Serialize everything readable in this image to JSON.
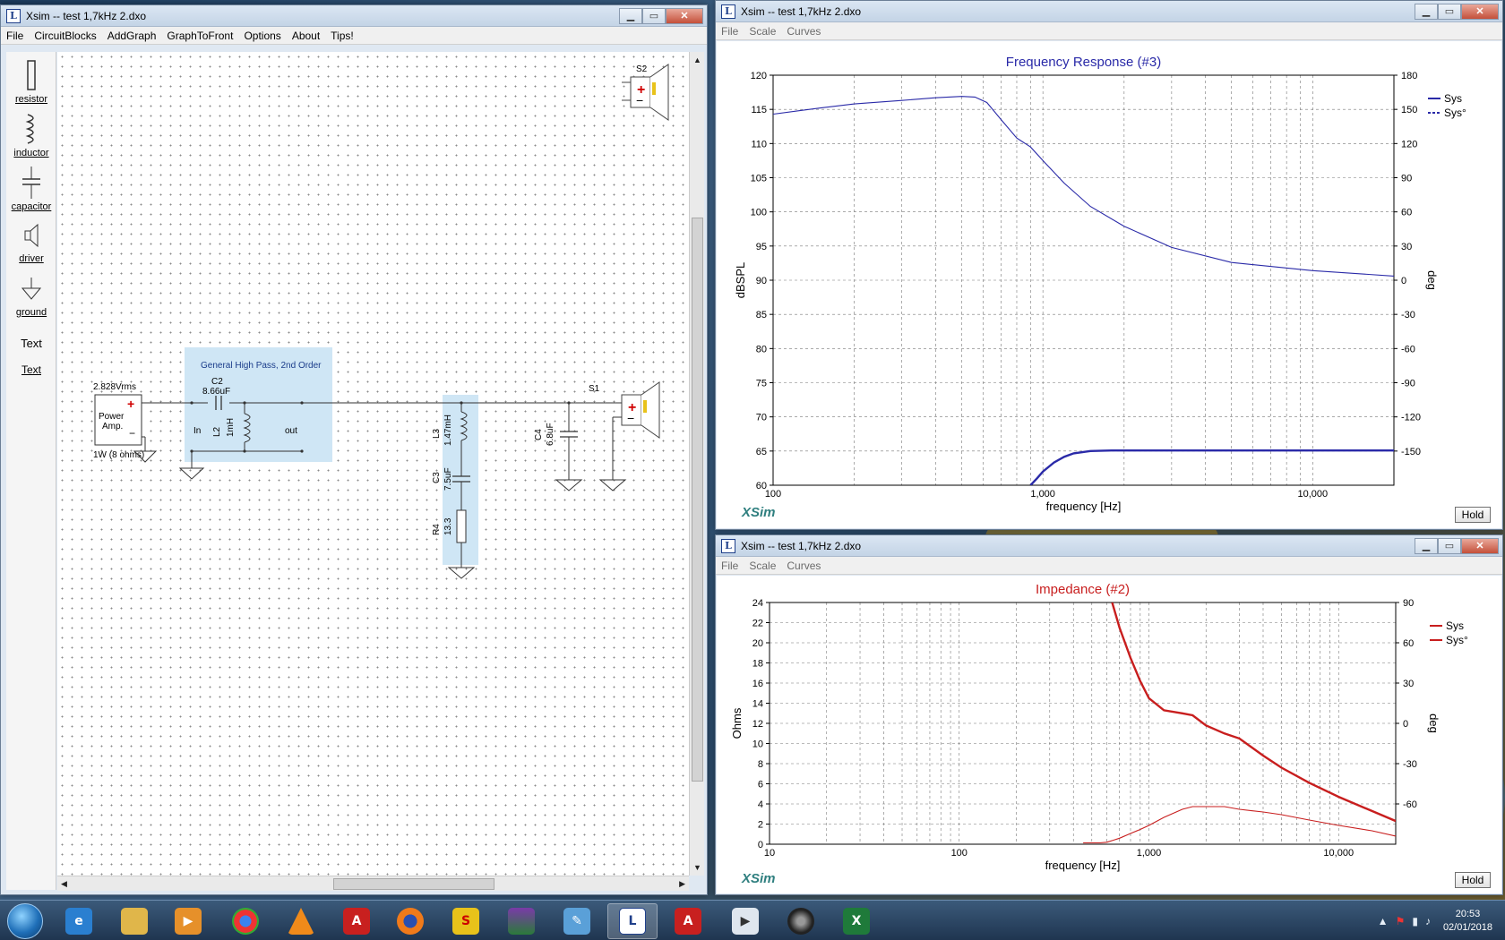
{
  "schematic_window": {
    "title": "Xsim -- test 1,7kHz 2.dxo",
    "menu": [
      "File",
      "CircuitBlocks",
      "AddGraph",
      "GraphToFront",
      "Options",
      "About",
      "Tips!"
    ],
    "tools": [
      {
        "label": "resistor",
        "icon": "resistor-icon"
      },
      {
        "label": "inductor",
        "icon": "inductor-icon"
      },
      {
        "label": "capacitor",
        "icon": "capacitor-icon"
      },
      {
        "label": "driver",
        "icon": "driver-icon"
      },
      {
        "label": "ground",
        "icon": "ground-icon"
      },
      {
        "label": "Text",
        "icon": "text-tool"
      },
      {
        "label": "Text",
        "icon": "text-link"
      }
    ],
    "circuit": {
      "source_voltage": "2.828Vrms",
      "source_name_line1": "Power",
      "source_name_line2": "Amp.",
      "source_power": "1W (8 ohms)",
      "block_title": "General High Pass, 2nd Order",
      "c2_name": "C2",
      "c2_value": "8.66uF",
      "l2_name": "L2",
      "l2_value": "1mH",
      "in_label": "In",
      "out_label": "out",
      "l3_name": "L3",
      "l3_value": "1.47mH",
      "c3_name": "C3",
      "c3_value": "7.5uF",
      "r4_name": "R4",
      "r4_value": "13.3",
      "c4_name": "C4",
      "c4_value": "6.8uF",
      "s1_name": "S1",
      "s2_name": "S2"
    }
  },
  "fr_window": {
    "title": "Xsim -- test 1,7kHz 2.dxo",
    "menu": [
      "File",
      "Scale",
      "Curves"
    ],
    "hold": "Hold",
    "logo": "XSim"
  },
  "imp_window": {
    "title": "Xsim -- test 1,7kHz 2.dxo",
    "menu": [
      "File",
      "Scale",
      "Curves"
    ],
    "hold": "Hold",
    "logo": "XSim"
  },
  "chart_data": [
    {
      "type": "line",
      "title": "Frequency Response (#3)",
      "xlabel": "frequency [Hz]",
      "ylabel": "dBSPL",
      "y2label": "deg",
      "xscale": "log",
      "xlim": [
        100,
        20000
      ],
      "ylim": [
        60,
        120
      ],
      "y2lim": [
        -180,
        180
      ],
      "xticks": [
        100,
        1000,
        10000
      ],
      "xtick_labels": [
        "100",
        "1,000",
        "10,000"
      ],
      "yticks": [
        60,
        65,
        70,
        75,
        80,
        85,
        90,
        95,
        100,
        105,
        110,
        115,
        120
      ],
      "y2ticks": [
        -150,
        -120,
        -90,
        -60,
        -30,
        0,
        30,
        60,
        90,
        120,
        150,
        180
      ],
      "legend_position": "top-right",
      "series": [
        {
          "name": "Sys",
          "axis": "left",
          "style": "solid",
          "color": "#2a2aa8",
          "x": [
            100,
            150,
            200,
            300,
            400,
            500,
            560,
            620,
            700,
            800,
            900,
            1000,
            1200,
            1500,
            2000,
            3000,
            5000,
            10000,
            20000
          ],
          "y": [
            114.3,
            115.2,
            115.8,
            116.3,
            116.7,
            116.9,
            116.8,
            116.0,
            113.5,
            110.8,
            109.5,
            107.5,
            104.2,
            100.8,
            97.9,
            94.8,
            92.6,
            91.4,
            90.6
          ]
        },
        {
          "name": "Sys°",
          "axis": "right",
          "style": "dashed",
          "color": "#2a2aa8",
          "x": [
            900,
            950,
            1000,
            1100,
            1200,
            1300,
            1500,
            1800,
            2000,
            3000,
            5000,
            10000,
            20000
          ],
          "y": [
            -180,
            -174,
            -168,
            -160,
            -155,
            -152,
            -150,
            -149.5,
            -149.5,
            -149.5,
            -149.5,
            -149.5,
            -149.5
          ]
        }
      ]
    },
    {
      "type": "line",
      "title": "Impedance (#2)",
      "xlabel": "frequency [Hz]",
      "ylabel": "Ohms",
      "y2label": "deg",
      "xscale": "log",
      "xlim": [
        10,
        20000
      ],
      "ylim": [
        0,
        24
      ],
      "y2lim": [
        -90,
        90
      ],
      "xticks": [
        10,
        100,
        1000,
        10000
      ],
      "xtick_labels": [
        "10",
        "100",
        "1,000",
        "10,000"
      ],
      "yticks": [
        0,
        2,
        4,
        6,
        8,
        10,
        12,
        14,
        16,
        18,
        20,
        22,
        24
      ],
      "y2ticks": [
        -60,
        -30,
        0,
        30,
        60,
        90
      ],
      "legend_position": "top-right",
      "series": [
        {
          "name": "Sys",
          "axis": "left",
          "style": "solid",
          "color": "#c81e1e",
          "x": [
            640,
            700,
            800,
            900,
            1000,
            1200,
            1500,
            1700,
            2000,
            2500,
            3000,
            4000,
            5000,
            7000,
            10000,
            15000,
            20000
          ],
          "y": [
            24,
            21.5,
            18.5,
            16.2,
            14.5,
            13.3,
            13.0,
            12.8,
            11.8,
            11.0,
            10.5,
            8.8,
            7.6,
            6.1,
            4.7,
            3.3,
            2.3
          ]
        },
        {
          "name": "Sys°",
          "axis": "right",
          "style": "solid",
          "color": "#c81e1e",
          "x": [
            450,
            550,
            600,
            650,
            700,
            800,
            900,
            1000,
            1200,
            1500,
            1700,
            2000,
            2500,
            3000,
            4000,
            5000,
            7000,
            10000,
            15000,
            20000
          ],
          "y": [
            -89,
            -89,
            -88.5,
            -87,
            -85.5,
            -82,
            -79,
            -76,
            -70,
            -64,
            -62,
            -62,
            -62,
            -64,
            -66,
            -68,
            -72,
            -76,
            -80,
            -84
          ]
        }
      ]
    }
  ],
  "taskbar": {
    "time": "20:53",
    "date": "02/01/2018",
    "items": [
      "start",
      "ie",
      "explorer",
      "media",
      "chrome",
      "vlc",
      "autocad",
      "firefox",
      "superman",
      "winrar",
      "paint",
      "xsim",
      "acrobat",
      "xsim2",
      "speaker",
      "excel"
    ]
  }
}
